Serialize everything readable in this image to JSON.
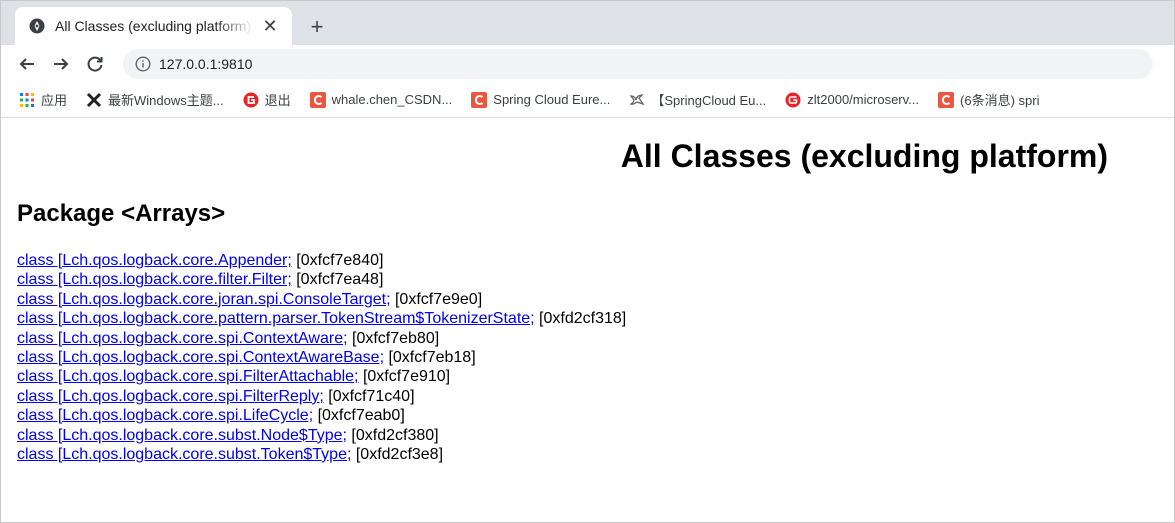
{
  "tab": {
    "title": "All Classes (excluding platform)",
    "favicon": "globe-icon",
    "close_label": "✕",
    "new_tab_label": "+"
  },
  "toolbar": {
    "back": "←",
    "forward": "→",
    "reload": "C",
    "url": "127.0.0.1:9810"
  },
  "bookmarks": [
    {
      "label": "应用",
      "icon": "apps-grid-icon",
      "color": "#1a73e8"
    },
    {
      "label": "最新Windows主题...",
      "icon": "x-logo-icon",
      "color": "#202124"
    },
    {
      "label": "退出",
      "icon": "red-circle-g-icon",
      "color": "#e8242b"
    },
    {
      "label": "whale.chen_CSDN...",
      "icon": "csdn-c-icon",
      "color": "#e9573f"
    },
    {
      "label": "Spring Cloud Eure...",
      "icon": "csdn-c-icon",
      "color": "#e9573f"
    },
    {
      "label": "【SpringCloud Eu...",
      "icon": "bird-icon",
      "color": "#5f6368"
    },
    {
      "label": "zlt2000/microserv...",
      "icon": "gitee-icon",
      "color": "#e8242b"
    },
    {
      "label": "(6条消息) spri",
      "icon": "csdn-c-icon",
      "color": "#e9573f"
    }
  ],
  "page": {
    "title": "All Classes (excluding platform)",
    "package_heading": "Package <Arrays>",
    "classes": [
      {
        "link": "class [Lch.qos.logback.core.Appender;",
        "addr": " [0xfcf7e840]"
      },
      {
        "link": "class [Lch.qos.logback.core.filter.Filter;",
        "addr": " [0xfcf7ea48]"
      },
      {
        "link": "class [Lch.qos.logback.core.joran.spi.ConsoleTarget;",
        "addr": " [0xfcf7e9e0]"
      },
      {
        "link": "class [Lch.qos.logback.core.pattern.parser.TokenStream$TokenizerState;",
        "addr": " [0xfd2cf318]"
      },
      {
        "link": "class [Lch.qos.logback.core.spi.ContextAware;",
        "addr": " [0xfcf7eb80]"
      },
      {
        "link": "class [Lch.qos.logback.core.spi.ContextAwareBase;",
        "addr": " [0xfcf7eb18]"
      },
      {
        "link": "class [Lch.qos.logback.core.spi.FilterAttachable;",
        "addr": " [0xfcf7e910]"
      },
      {
        "link": "class [Lch.qos.logback.core.spi.FilterReply;",
        "addr": " [0xfcf71c40]"
      },
      {
        "link": "class [Lch.qos.logback.core.spi.LifeCycle;",
        "addr": " [0xfcf7eab0]"
      },
      {
        "link": "class [Lch.qos.logback.core.subst.Node$Type;",
        "addr": " [0xfd2cf380]"
      },
      {
        "link": "class [Lch.qos.logback.core.subst.Token$Type;",
        "addr": " [0xfd2cf3e8]"
      }
    ]
  },
  "colors": {
    "link": "#0000ee",
    "tabstrip_bg": "#dee1e6",
    "omnibox_bg": "#f1f3f4"
  }
}
